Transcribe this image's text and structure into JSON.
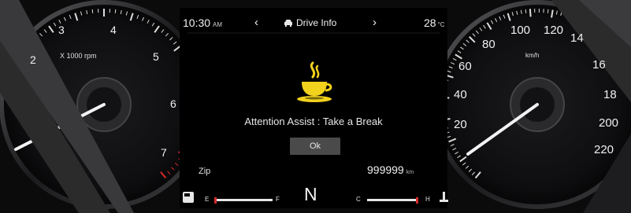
{
  "header": {
    "time": "10:30",
    "time_suffix": "AM",
    "prev_icon": "chevron-left",
    "next_icon": "chevron-right",
    "screen_icon": "car-icon",
    "screen_title": "Drive Info",
    "temperature": "28",
    "temperature_unit": "°C"
  },
  "alert": {
    "icon": "coffee-cup-icon",
    "icon_color": "#f2d21c",
    "message": "Attention Assist : Take a Break",
    "button_label": "Ok"
  },
  "trip": {
    "label": "Zip",
    "odometer": "999999",
    "odometer_unit": "km"
  },
  "gear": "N",
  "tachometer": {
    "unit_label": "X 1000 rpm",
    "tick_labels": [
      "2",
      "3",
      "4",
      "5",
      "6",
      "7"
    ],
    "redline_color": "#d92a2a"
  },
  "speedometer": {
    "unit_label": "km/h",
    "tick_labels": [
      "20",
      "40",
      "60",
      "80",
      "100",
      "120",
      "14",
      "16",
      "18",
      "200",
      "220"
    ]
  },
  "fuel_gauge": {
    "icon": "fuel-pump-icon",
    "empty_label": "E",
    "full_label": "F"
  },
  "temp_gauge": {
    "icon": "coolant-temperature-icon",
    "cold_label": "C",
    "hot_label": "H"
  }
}
